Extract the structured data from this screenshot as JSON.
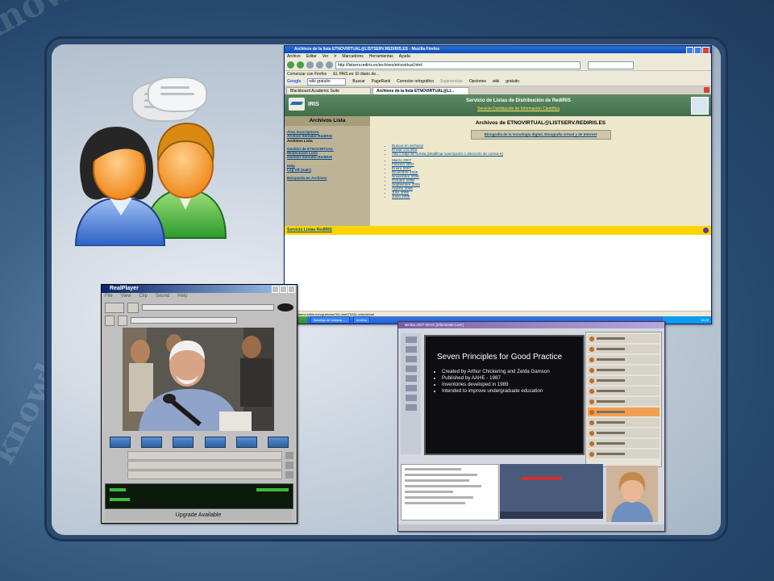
{
  "background": {
    "lettering": "knowledge is power is knowledge is power",
    "accent_color": "#27486e"
  },
  "browser": {
    "window_title": "Archivos de la lista ETNOVIRTUAL@LISTSERV.REDIRIS.ES - Mozilla Firefox",
    "menu": [
      "Archivo",
      "Editar",
      "Ver",
      "Ir",
      "Marcadores",
      "Herramientas",
      "Ayuda"
    ],
    "url": "http://listserv.rediris.es/archives/etnovirtual.html",
    "bookmarks": [
      "Comenzar con Firefox",
      "EL PAIS.es: El diario de..."
    ],
    "google_toolbar": {
      "query": "wiki gratuito",
      "buttons": [
        "Buscar",
        "PageRank",
        "Corrector ortográfico",
        "Sugerencias",
        "Opciones",
        "wiki",
        "gratuito"
      ]
    },
    "tabs": [
      "Blackboard Academic Suite",
      "Archivos de la lista ETNOVIRTUAL@LI..."
    ],
    "status_url": "http://listserv.rediris.es/cgi-bin/wa?A1=ind0702&L=etnovirtual",
    "taskbar": {
      "start": "Inicio",
      "tasks": [
        "Bandeja de entrada -...",
        "Archivo"
      ],
      "clock": "16:23"
    }
  },
  "rediris": {
    "logo_text": "IRIS",
    "header_title": "Servicio de Listas de Distribución de RedIRIS",
    "header_sub": "Servicio Distribución de Información Científica",
    "sidebar": {
      "heading": "Archivos Lista",
      "group1": [
        "Área Suscriptores",
        "Archivo Servidor RedIRIS",
        "Archivos Lista"
      ],
      "group2": [
        "Gestión de ETNOVIRTUAL",
        "Moderación Lista",
        "Gestión Servidor RedIRIS"
      ],
      "group3": [
        "Help",
        "Log off (Salir)"
      ],
      "group4": [
        "Búsqueda en Archivos"
      ]
    },
    "main": {
      "heading": "Archivos de ETNOVIRTUAL@LISTSERV.REDIRIS.ES",
      "description": "Etnografía de la tecnología digital. Etnografía virtual y de Internet",
      "actions": [
        "Buscar en archivos",
        "Enviar a la lista",
        "Alta o baja de la lista (Modificar suscripción o dirección de correo-e)"
      ],
      "months": [
        "Marzo 2007",
        "Febrero 2007",
        "Enero 2007",
        "Diciembre 2006",
        "Noviembre 2006",
        "Octubre 2006",
        "Septiembre 2006",
        "Agosto 2006",
        "Julio 2006",
        "Junio 2006"
      ]
    },
    "footer": "Servicio Listas RedIRIS"
  },
  "realplayer": {
    "title": "RealPlayer",
    "menu": [
      "File",
      "View",
      "Clip",
      "Sound",
      "Help"
    ],
    "upgrade": "Upgrade Available"
  },
  "elluminate": {
    "title": "wimba 2007-08-01 [Elluminate Live!]",
    "slide_heading": "Seven Principles for Good Practice",
    "slide_bullets": [
      "Created by Arthur Chickering and Zelda Gamson",
      "Published by AAHE - 1987",
      "Inventories developed in 1989",
      "Intended to improve undergraduate education"
    ]
  }
}
